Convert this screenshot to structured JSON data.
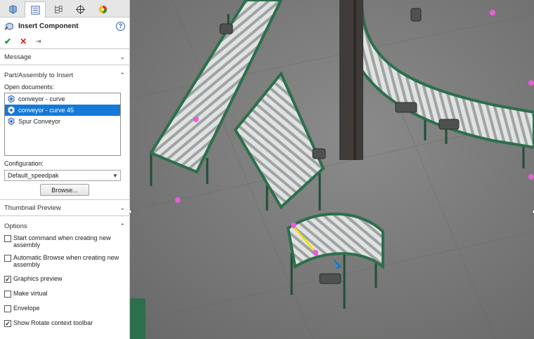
{
  "tabs": [
    {
      "icon": "feature-manager-icon"
    },
    {
      "icon": "property-manager-icon"
    },
    {
      "icon": "configuration-manager-icon"
    },
    {
      "icon": "dimxpert-manager-icon"
    },
    {
      "icon": "display-manager-icon"
    }
  ],
  "property_manager": {
    "title": "Insert Component",
    "help_label": "?",
    "actions": {
      "ok": "✔",
      "cancel": "✕",
      "pin": "⇥"
    },
    "message_section": "Message",
    "part_section": "Part/Assembly to Insert",
    "open_documents_label": "Open documents:",
    "documents": [
      {
        "name": "conveyor - curve",
        "selected": false
      },
      {
        "name": "conveyor - curve 45",
        "selected": true
      },
      {
        "name": "Spur Conveyor",
        "selected": false
      }
    ],
    "configuration_label": "Configuration:",
    "configuration_value": "Default_speedpak",
    "browse_button": "Browse...",
    "thumbnail_section": "Thumbnail Preview",
    "options_section": "Options",
    "options": [
      {
        "label": "Start command when creating new assembly",
        "checked": false
      },
      {
        "label": "Automatic Browse when creating new assembly",
        "checked": false
      },
      {
        "label": "Graphics preview",
        "checked": true
      },
      {
        "label": "Make virtual",
        "checked": false
      },
      {
        "label": "Envelope",
        "checked": false
      },
      {
        "label": "Show Rotate context toolbar",
        "checked": true
      }
    ]
  },
  "colors": {
    "frame_green": "#2c6f4c",
    "roller_silver": "#d6d8d8",
    "floor_gray": "#7a7b7a",
    "selection_blue": "#1679d8",
    "point_magenta": "#e85fd6"
  }
}
